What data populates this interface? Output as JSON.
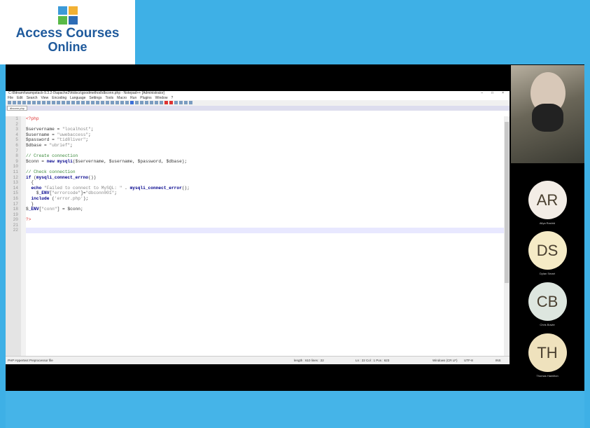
{
  "logo": {
    "line1": "Access Courses",
    "line2": "Online",
    "colors": [
      "#3c9ad8",
      "#f2b134",
      "#59b947",
      "#2d6cb5"
    ]
  },
  "editor": {
    "title": "C:\\Bitnami\\wampstack-9.3.2-0\\apache2\\htdocs\\goodmethod\\dbconn.php - Notepad++ [Administrator]",
    "window_controls": [
      "–",
      "□",
      "×"
    ],
    "menu": [
      "File",
      "Edit",
      "Search",
      "View",
      "Encoding",
      "Language",
      "Settings",
      "Tools",
      "Macro",
      "Run",
      "Plugins",
      "Window",
      "?"
    ],
    "tab": "dbconn.php",
    "current_line": 22,
    "code": [
      "<?php",
      "",
      "$servername = \"localhost\";",
      "$username = \"uwebaccess\";",
      "$password = \"tid8liver\";",
      "$dbase = \"ubrief\";",
      "",
      "// Create connection",
      "$conn = new mysqli($servername, $username, $password, $dbase);",
      "",
      "// Check connection",
      "if (mysqli_connect_errno())",
      "  {",
      "  echo \"Failed to connect to MySQL: \" . mysqli_connect_error();",
      "    $_ENV[\"errorcode\"]=\"dbconn001\";",
      "  include ('error.php');",
      "  }",
      "$_ENV[\"conn\"] = $conn;",
      "",
      "?>",
      "",
      ""
    ],
    "status": {
      "filetype": "PHP Hypertext Preprocessor file",
      "length": "length : 610   lines : 22",
      "position": "Ln : 22   Col : 1   Pos : 623",
      "eol": "Windows (CR LF)",
      "encoding": "UTF-8",
      "mode": "INS"
    }
  },
  "participants": [
    {
      "initials": "AR",
      "name": "Aliya Rashid",
      "color": "#f3ede6"
    },
    {
      "initials": "DS",
      "name": "Dylan Smart",
      "color": "#f5ebc6"
    },
    {
      "initials": "CB",
      "name": "Chris Bowle",
      "color": "#dde6df"
    },
    {
      "initials": "TH",
      "name": "Thomas Hamilton",
      "color": "#efe2bd"
    }
  ]
}
